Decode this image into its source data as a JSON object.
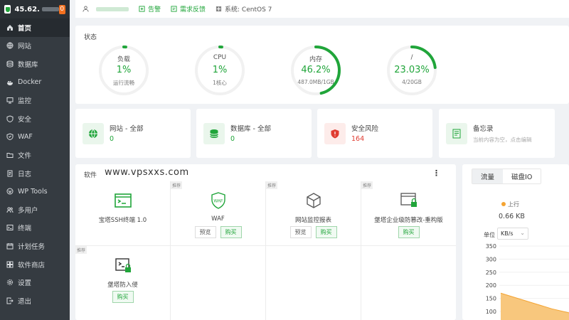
{
  "sidebar": {
    "ip": "45.62.",
    "badge": "0",
    "items": [
      {
        "label": "首页",
        "icon": "home-icon",
        "active": true
      },
      {
        "label": "网站",
        "icon": "globe-icon"
      },
      {
        "label": "数据库",
        "icon": "database-icon"
      },
      {
        "label": "Docker",
        "icon": "docker-icon"
      },
      {
        "label": "监控",
        "icon": "monitor-icon"
      },
      {
        "label": "安全",
        "icon": "shield-icon"
      },
      {
        "label": "WAF",
        "icon": "waf-shield-icon"
      },
      {
        "label": "文件",
        "icon": "folder-icon"
      },
      {
        "label": "日志",
        "icon": "log-icon"
      },
      {
        "label": "WP Tools",
        "icon": "wordpress-icon"
      },
      {
        "label": "多用户",
        "icon": "users-icon"
      },
      {
        "label": "终端",
        "icon": "terminal-icon"
      },
      {
        "label": "计划任务",
        "icon": "calendar-icon"
      },
      {
        "label": "软件商店",
        "icon": "store-icon"
      },
      {
        "label": "设置",
        "icon": "gear-icon"
      },
      {
        "label": "退出",
        "icon": "logout-icon"
      }
    ]
  },
  "topbar": {
    "alert_label": "告警",
    "feedback_label": "需求反馈",
    "system_label": "系统: CentOS 7"
  },
  "status": {
    "title": "状态",
    "gauges": [
      {
        "label": "负载",
        "value": "1%",
        "sub": "运行流畅",
        "fraction": 0.01
      },
      {
        "label": "CPU",
        "value": "1%",
        "sub": "1核心",
        "fraction": 0.01
      },
      {
        "label": "内存",
        "value": "46.2%",
        "sub": "487.0MB/1GB",
        "fraction": 0.462
      },
      {
        "label": "/",
        "value": "23.03%",
        "sub": "4/20GB",
        "fraction": 0.2303
      }
    ]
  },
  "summary": [
    {
      "title": "网站 - 全部",
      "value": "0",
      "icon": "globe-icon"
    },
    {
      "title": "数据库 - 全部",
      "value": "0",
      "icon": "database-icon"
    },
    {
      "title": "安全风险",
      "value": "164",
      "icon": "shield-warning-icon"
    },
    {
      "title": "备忘录",
      "sub": "当前内容为空，点击编辑",
      "icon": "notes-icon"
    }
  ],
  "software": {
    "title": "软件",
    "watermark": "www.vpsxxs.com",
    "tag": "推荐",
    "preview_label": "预览",
    "buy_label": "购买",
    "tiles": [
      {
        "name": "宝塔SSH终端 1.0",
        "icon": "terminal-window-icon",
        "tag": false,
        "preview": false,
        "buy": false
      },
      {
        "name": "WAF",
        "icon": "waf-shield-icon",
        "tag": true,
        "preview": true,
        "buy": true
      },
      {
        "name": "网站监控报表",
        "icon": "cube-icon",
        "tag": true,
        "preview": true,
        "buy": true
      },
      {
        "name": "堡塔企业级防篡改-重构版",
        "icon": "browser-lock-icon",
        "tag": true,
        "preview": false,
        "buy": true
      },
      {
        "name": "堡塔防入侵",
        "icon": "terminal-lock-icon",
        "tag": true,
        "preview": false,
        "buy": true
      }
    ]
  },
  "traffic": {
    "tab_traffic": "流量",
    "tab_disk": "磁盘IO",
    "legend_up": "上行",
    "up_value": "0.66 KB",
    "unit_label": "单位",
    "unit_value": "KB/s",
    "accent": "#f4a433"
  },
  "chart_data": {
    "type": "area",
    "yticks": [
      350,
      300,
      250,
      200,
      150,
      100
    ],
    "series": [
      {
        "name": "上行",
        "values": [
          170,
          150,
          130,
          110,
          95
        ]
      }
    ]
  },
  "colors": {
    "accent": "#20a53a",
    "danger": "#e03c31",
    "sidebar": "#353b41"
  }
}
